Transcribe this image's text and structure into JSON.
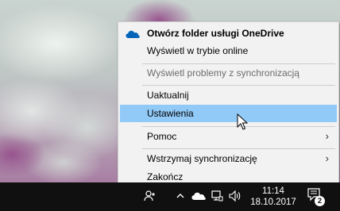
{
  "menu": {
    "items": [
      {
        "label": "Otwórz folder usługi OneDrive",
        "icon": "onedrive-cloud-icon"
      },
      {
        "label": "Wyświetl w trybie online"
      },
      {
        "label": "Wyświetl problemy z synchronizacją"
      },
      {
        "label": "Uaktualnij"
      },
      {
        "label": "Ustawienia"
      },
      {
        "label": "Pomoc",
        "submenu_icon": "chevron-right-icon"
      },
      {
        "label": "Wstrzymaj synchronizację",
        "submenu_icon": "chevron-right-icon"
      },
      {
        "label": "Zakończ"
      }
    ],
    "highlight_color": "#91c9f7"
  },
  "taskbar": {
    "clock_time": "11:14",
    "clock_date": "18.10.2017",
    "notification_count": "2",
    "tray_icons": [
      "people-icon",
      "chevron-up-icon",
      "onedrive-tray-icon",
      "network-icon",
      "volume-icon"
    ]
  },
  "colors": {
    "taskbar": "#101010",
    "onedrive_blue": "#0364b8"
  }
}
